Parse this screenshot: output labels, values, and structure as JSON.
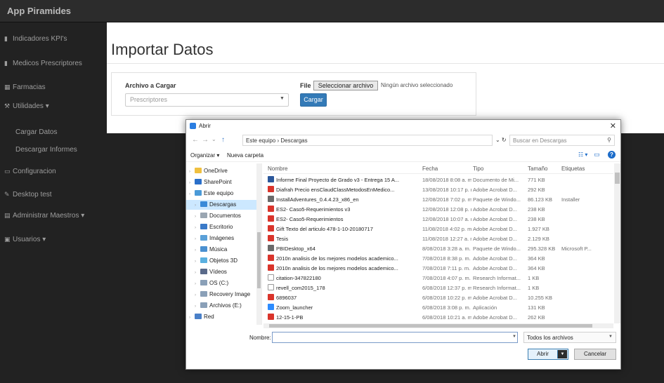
{
  "app": {
    "brand": "App Piramides"
  },
  "sidebar": {
    "items": [
      {
        "label": "Indicadores KPI's",
        "icon": "bar-chart-icon"
      },
      {
        "label": "Medicos Prescriptores",
        "icon": "bar-chart-icon"
      },
      {
        "label": "Farmacias",
        "icon": "table-icon"
      },
      {
        "label": "Utilidades ▾",
        "icon": "wrench-icon"
      },
      {
        "label": "Cargar Datos",
        "icon": ""
      },
      {
        "label": "Descargar Informes",
        "icon": ""
      },
      {
        "label": "Configuracion",
        "icon": "monitor-icon"
      },
      {
        "label": "Desktop test",
        "icon": "pencil-icon"
      },
      {
        "label": "Administrar Maestros ▾",
        "icon": "building-icon"
      },
      {
        "label": "Usuarios ▾",
        "icon": "users-icon"
      }
    ]
  },
  "main": {
    "title": "Importar Datos",
    "file_label": "Archivo a Cargar",
    "select_value": "Prescriptores",
    "file_field_label": "File",
    "file_button": "Seleccionar archivo",
    "file_status": "Ningún archivo seleccionado",
    "upload_button": "Cargar"
  },
  "dialog": {
    "title": "Abrir",
    "address": "Este equipo  ›  Descargas",
    "search_placeholder": "Buscar en Descargas",
    "organize": "Organizar ▾",
    "new_folder": "Nueva carpeta",
    "nav_items": [
      {
        "label": "OneDrive",
        "color": "#f0c040",
        "selected": false,
        "indent": 0
      },
      {
        "label": "SharePoint",
        "color": "#2a6fc9",
        "selected": false,
        "indent": 0
      },
      {
        "label": "Este equipo",
        "color": "#4a9ad8",
        "selected": false,
        "indent": 0
      },
      {
        "label": "Descargas",
        "color": "#3a8ad8",
        "selected": true,
        "indent": 1
      },
      {
        "label": "Documentos",
        "color": "#9aa6b2",
        "selected": false,
        "indent": 1
      },
      {
        "label": "Escritorio",
        "color": "#3a7ac8",
        "selected": false,
        "indent": 1
      },
      {
        "label": "Imágenes",
        "color": "#5aa0d8",
        "selected": false,
        "indent": 1
      },
      {
        "label": "Música",
        "color": "#4a90d0",
        "selected": false,
        "indent": 1
      },
      {
        "label": "Objetos 3D",
        "color": "#5ab0e0",
        "selected": false,
        "indent": 1
      },
      {
        "label": "Vídeos",
        "color": "#5a6a8a",
        "selected": false,
        "indent": 1
      },
      {
        "label": "OS (C:)",
        "color": "#8aa0b8",
        "selected": false,
        "indent": 1
      },
      {
        "label": "Recovery Image",
        "color": "#8aa0b8",
        "selected": false,
        "indent": 1
      },
      {
        "label": "Archivos (E:)",
        "color": "#8aa0b8",
        "selected": false,
        "indent": 1
      },
      {
        "label": "Red",
        "color": "#4a80c8",
        "selected": false,
        "indent": 0
      }
    ],
    "columns": [
      "Nombre",
      "Fecha",
      "Tipo",
      "Tamaño",
      "Etiquetas"
    ],
    "files": [
      {
        "name": "Informe Final Proyecto de Grado v3 - Entrega 15 A...",
        "date": "18/08/2018 8:08 a. m.",
        "type": "Documento de Mi...",
        "size": "771 KB",
        "tag": "",
        "icon": "#2b579a"
      },
      {
        "name": "Diafrah Precio ensClaudClassMetodosEnMedico...",
        "date": "13/08/2018 10:17 p. m.",
        "type": "Adobe Acrobat D...",
        "size": "292 KB",
        "tag": "",
        "icon": "#d9342b"
      },
      {
        "name": "InstallAdventures_0.4.4.23_x86_en",
        "date": "12/08/2018 7:02 p. m.",
        "type": "Paquete de Windo...",
        "size": "86.123 KB",
        "tag": "Installer",
        "icon": "#6a6a6a"
      },
      {
        "name": "ES2- Caso5-Requerimientos v3",
        "date": "12/08/2018 12:08 p. m.",
        "type": "Adobe Acrobat D...",
        "size": "238 KB",
        "tag": "",
        "icon": "#d9342b"
      },
      {
        "name": "ES2- Caso5-Requerimientos",
        "date": "12/08/2018 10:07 a. m.",
        "type": "Adobe Acrobat D...",
        "size": "238 KB",
        "tag": "",
        "icon": "#d9342b"
      },
      {
        "name": "Gift Texto del articulo 478-1-10-20180717",
        "date": "11/08/2018 4:02 p. m.",
        "type": "Adobe Acrobat D...",
        "size": "1.927 KB",
        "tag": "",
        "icon": "#d9342b"
      },
      {
        "name": "Tesis",
        "date": "11/08/2018 12:27 a. m.",
        "type": "Adobe Acrobat D...",
        "size": "2.129 KB",
        "tag": "",
        "icon": "#d9342b"
      },
      {
        "name": "PBIDesktop_x64",
        "date": "8/08/2018 3:28 a. m.",
        "type": "Paquete de Windo...",
        "size": "295.328 KB",
        "tag": "Microsoft P...",
        "icon": "#6a6a6a"
      },
      {
        "name": "2010n analisis de los mejores modelos academico...",
        "date": "7/08/2018 8:38 p. m.",
        "type": "Adobe Acrobat D...",
        "size": "364 KB",
        "tag": "",
        "icon": "#d9342b"
      },
      {
        "name": "2010n analisis de los mejores modelos academico...",
        "date": "7/08/2018 7:11 p. m.",
        "type": "Adobe Acrobat D...",
        "size": "364 KB",
        "tag": "",
        "icon": "#d9342b"
      },
      {
        "name": "citation-347822180",
        "date": "7/08/2018 4:07 p. m.",
        "type": "Research Informat...",
        "size": "1 KB",
        "tag": "",
        "icon": "#ffffff"
      },
      {
        "name": "revell_com2015_178",
        "date": "6/08/2018 12:37 p. m.",
        "type": "Research Informat...",
        "size": "1 KB",
        "tag": "",
        "icon": "#ffffff"
      },
      {
        "name": "6896037",
        "date": "6/08/2018 10:22 p. m.",
        "type": "Adobe Acrobat D...",
        "size": "10.255 KB",
        "tag": "",
        "icon": "#d9342b"
      },
      {
        "name": "Zoom_launcher",
        "date": "6/08/2018 3:08 p. m.",
        "type": "Aplicación",
        "size": "131 KB",
        "tag": "",
        "icon": "#2d8cff"
      },
      {
        "name": "12-15-1-PB",
        "date": "6/08/2018 10:21 a. m.",
        "type": "Adobe Acrobat D...",
        "size": "262 KB",
        "tag": "",
        "icon": "#d9342b"
      }
    ],
    "filename_label": "Nombre:",
    "filename_value": "",
    "filetype": "Todos los archivos",
    "open_button": "Abrir",
    "cancel_button": "Cancelar"
  }
}
